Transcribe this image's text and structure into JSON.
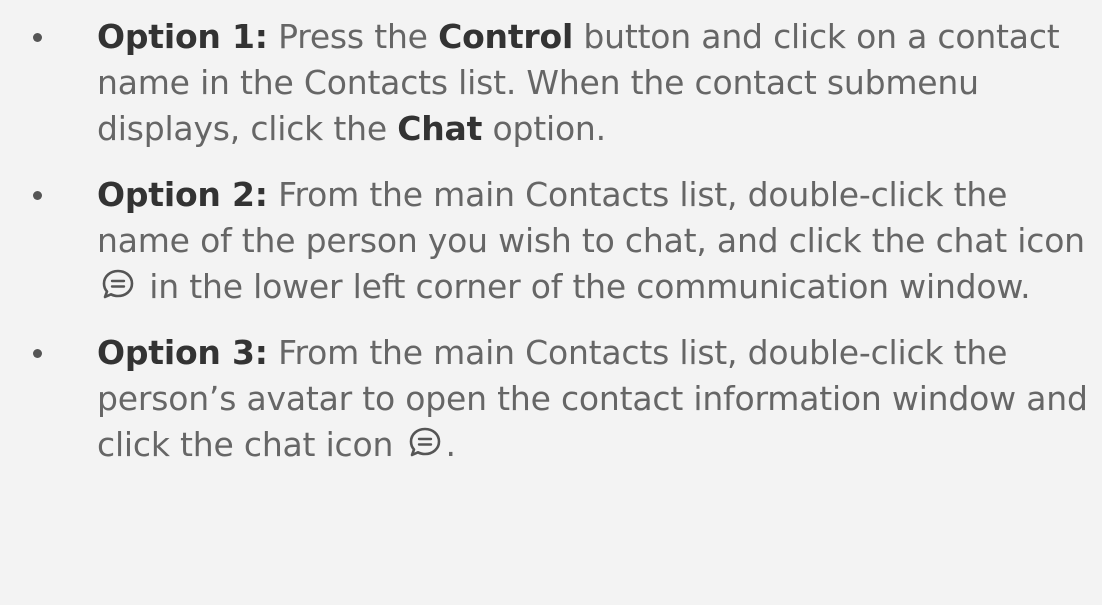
{
  "options": [
    {
      "label": "Option 1:",
      "text": [
        " Press the ",
        "Control",
        " button and click on a contact name in the Contacts list. When the contact submenu displays, click the ",
        "Chat",
        " option."
      ]
    },
    {
      "label": "Option 2:",
      "text": [
        " From the main Contacts list, double-click the name of the person you wish to chat, and click the chat icon",
        " in the lower left corner of the communication window."
      ],
      "icon": "chat-bubble-icon"
    },
    {
      "label": "Option 3:",
      "text": [
        " From the main Contacts list, double-click the person’s avatar to open the contact information window and click the chat icon",
        "."
      ],
      "icon": "chat-bubble-icon"
    }
  ]
}
